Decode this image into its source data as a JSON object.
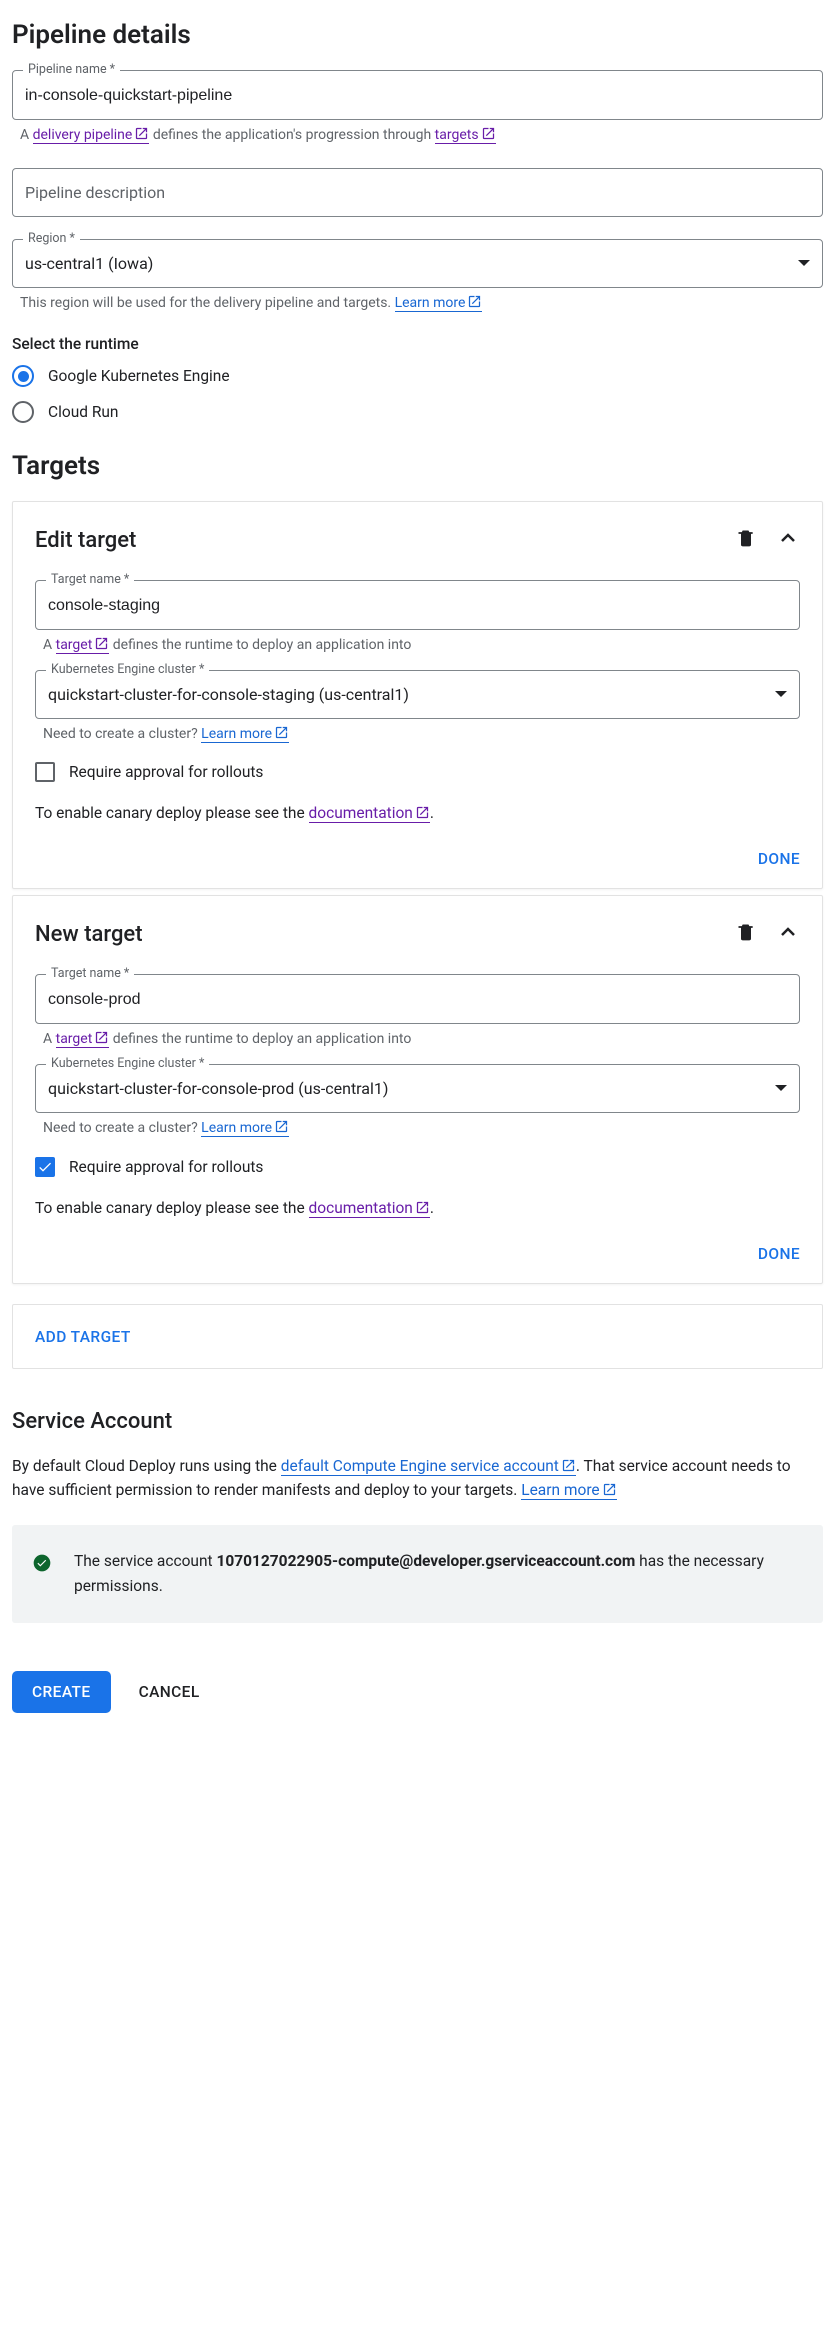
{
  "pipeline_details": {
    "title": "Pipeline details",
    "name_label": "Pipeline name *",
    "name_value": "in-console-quickstart-pipeline",
    "helper_a": "A ",
    "helper_link": "delivery pipeline",
    "helper_rest": " defines the application's progression through ",
    "helper_targets_link": "targets",
    "desc_placeholder": "Pipeline description",
    "region_label": "Region *",
    "region_value": "us-central1 (Iowa)",
    "region_helper": "This region will be used for the delivery pipeline and targets. ",
    "region_learn_more": "Learn more"
  },
  "runtime": {
    "label": "Select the runtime",
    "options": [
      {
        "label": "Google Kubernetes Engine",
        "checked": true
      },
      {
        "label": "Cloud Run",
        "checked": false
      }
    ]
  },
  "targets_section": {
    "title": "Targets",
    "add_target_label": "ADD TARGET",
    "targets": [
      {
        "card_title": "Edit target",
        "name_label": "Target name *",
        "name_value": "console-staging",
        "helper_a": "A ",
        "helper_target_link": "target",
        "helper_rest": " defines the runtime to deploy an application into",
        "cluster_label": "Kubernetes Engine cluster *",
        "cluster_value": "quickstart-cluster-for-console-staging (us-central1)",
        "cluster_helper": "Need to create a cluster? ",
        "cluster_learn_more": "Learn more",
        "approval_checked": false,
        "approval_label": "Require approval for rollouts",
        "canary_prefix": "To enable canary deploy please see the ",
        "canary_link": "documentation",
        "done_label": "DONE"
      },
      {
        "card_title": "New target",
        "name_label": "Target name *",
        "name_value": "console-prod",
        "helper_a": "A ",
        "helper_target_link": "target",
        "helper_rest": " defines the runtime to deploy an application into",
        "cluster_label": "Kubernetes Engine cluster *",
        "cluster_value": "quickstart-cluster-for-console-prod (us-central1)",
        "cluster_helper": "Need to create a cluster? ",
        "cluster_learn_more": "Learn more",
        "approval_checked": true,
        "approval_label": "Require approval for rollouts",
        "canary_prefix": "To enable canary deploy please see the ",
        "canary_link": "documentation",
        "done_label": "DONE"
      }
    ]
  },
  "service_account": {
    "title": "Service Account",
    "body_prefix": "By default Cloud Deploy runs using the ",
    "body_link": "default Compute Engine service account",
    "body_rest": ". That service account needs to have sufficient permission to render manifests and deploy to your targets. ",
    "body_learn_more": "Learn more",
    "info_prefix": "The service account ",
    "info_email": "1070127022905-compute@developer.gserviceaccount.com",
    "info_suffix": " has the necessary permissions."
  },
  "footer": {
    "create": "CREATE",
    "cancel": "CANCEL"
  }
}
